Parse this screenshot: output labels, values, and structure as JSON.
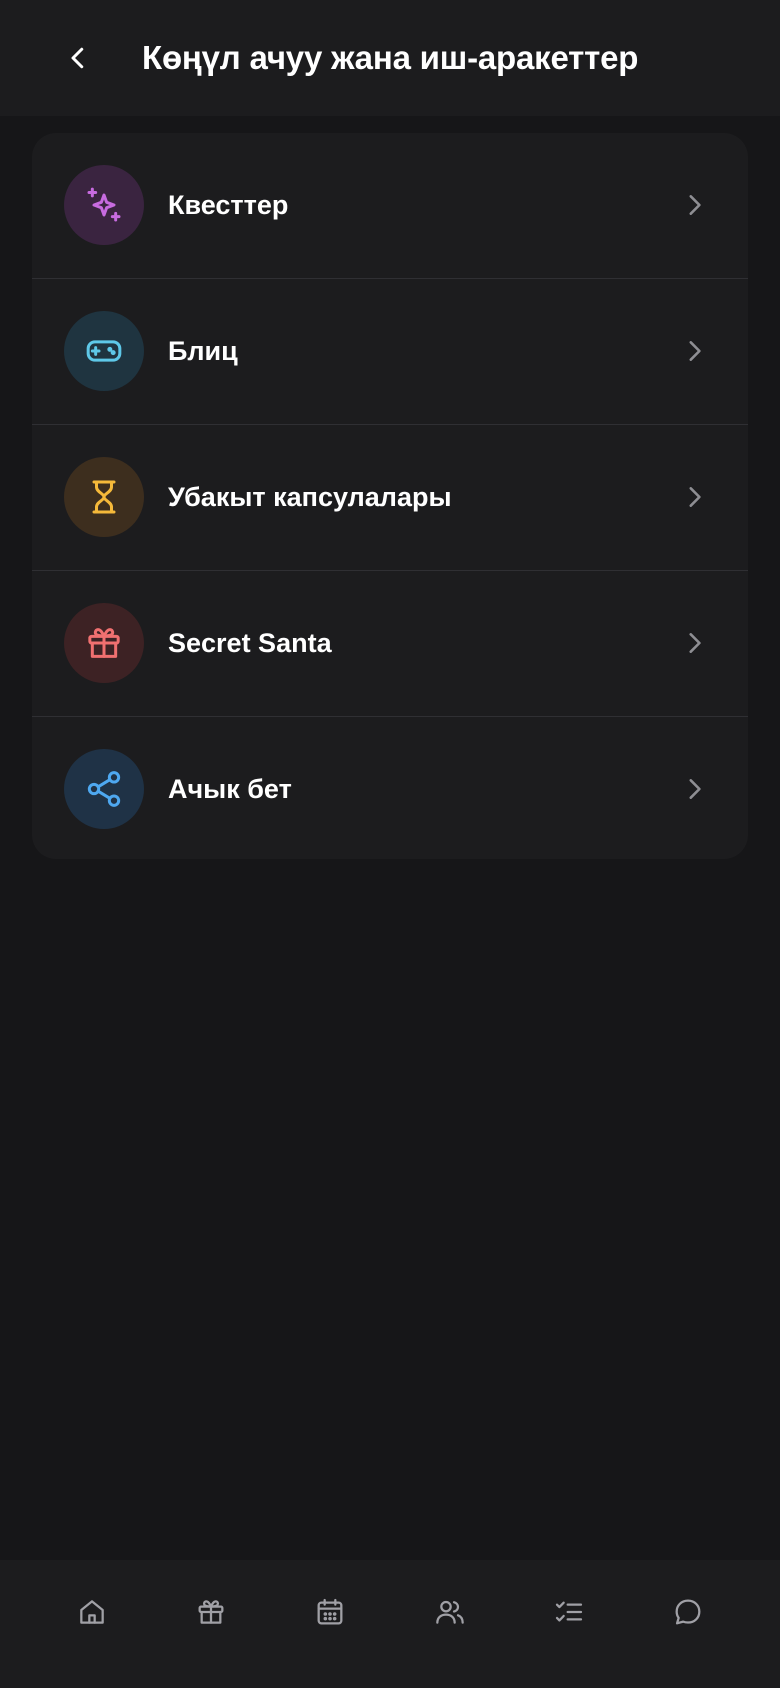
{
  "header": {
    "title": "Көңүл ачуу жана иш-аракеттер",
    "back_icon": "chevron-left-icon"
  },
  "menu": {
    "items": [
      {
        "label": "Квесттер",
        "icon": "sparkles-icon",
        "icon_color": "#c86be0",
        "icon_bg": "#3a2440"
      },
      {
        "label": "Блиц",
        "icon": "gamepad-icon",
        "icon_color": "#5ec8e8",
        "icon_bg": "#1f3440"
      },
      {
        "label": "Убакыт капсулалары",
        "icon": "hourglass-icon",
        "icon_color": "#f5b93a",
        "icon_bg": "#3d2e1e"
      },
      {
        "label": "Secret Santa",
        "icon": "gift-icon",
        "icon_color": "#f07070",
        "icon_bg": "#3d2224"
      },
      {
        "label": "Ачык бет",
        "icon": "share-icon",
        "icon_color": "#4ea8f0",
        "icon_bg": "#1f3246"
      }
    ]
  },
  "bottom_nav": {
    "items": [
      "home-icon",
      "gift-icon",
      "calendar-icon",
      "users-icon",
      "checklist-icon",
      "chat-icon"
    ]
  },
  "colors": {
    "background": "#161618",
    "surface": "#1c1c1e",
    "divider": "#2f2f33",
    "chevron": "#8e8e93",
    "nav_icon": "#a0a0a6"
  }
}
